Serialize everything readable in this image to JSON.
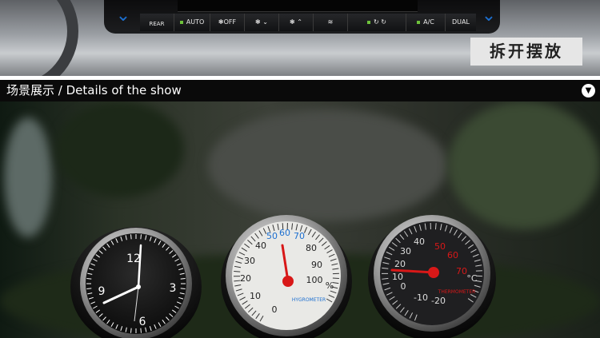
{
  "control_panel": {
    "buttons": [
      "REAR",
      "AUTO",
      "OFF",
      "A/C",
      "DUAL"
    ],
    "action_label": "拆开摆放"
  },
  "section_bar": {
    "title": "场景展示 / Details of the show"
  },
  "gauges": {
    "clock": {
      "numbers": [
        "12",
        "3",
        "6",
        "9"
      ]
    },
    "hygrometer": {
      "numbers": [
        "0",
        "10",
        "20",
        "30",
        "40",
        "50",
        "60",
        "70",
        "80",
        "90",
        "100"
      ],
      "unit": "%",
      "label": "HYGROMETER"
    },
    "thermometer": {
      "numbers": [
        "-20",
        "-10",
        "0",
        "10",
        "20",
        "30",
        "40",
        "50",
        "60",
        "70"
      ],
      "unit": "°C",
      "label": "THERMOMETER"
    }
  },
  "colors": {
    "accent_blue": "#1c6fd0",
    "needle_red": "#d81818",
    "label_bg": "#e6e6e6",
    "bar_bg": "#0a0a0a"
  }
}
